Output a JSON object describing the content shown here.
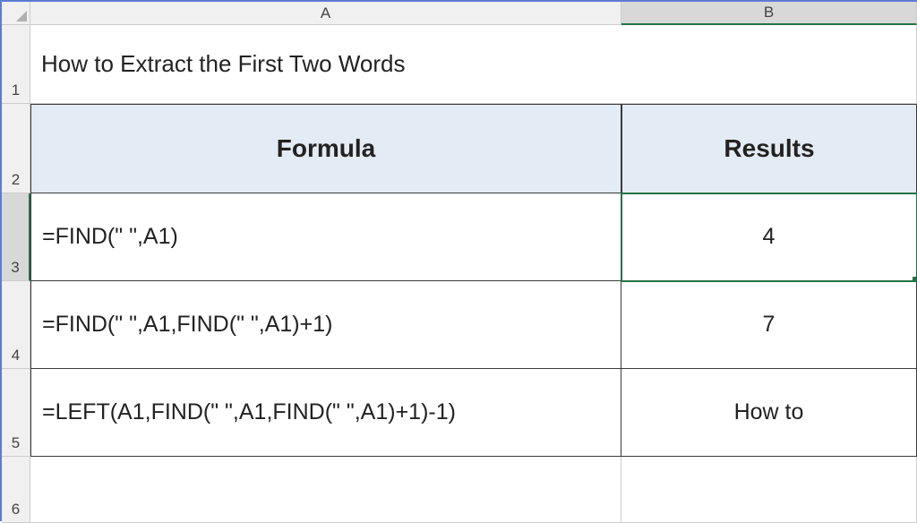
{
  "columns": {
    "A": "A",
    "B": "B"
  },
  "rows": {
    "r1": "1",
    "r2": "2",
    "r3": "3",
    "r4": "4",
    "r5": "5",
    "r6": "6"
  },
  "title": "How to Extract the First Two Words",
  "header": {
    "formula": "Formula",
    "results": "Results"
  },
  "data": [
    {
      "formula": "=FIND(\" \",A1)",
      "result": "4"
    },
    {
      "formula": "=FIND(\" \",A1,FIND(\" \",A1)+1)",
      "result": "7"
    },
    {
      "formula": "=LEFT(A1,FIND(\" \",A1,FIND(\" \",A1)+1)-1)",
      "result": "How to"
    }
  ]
}
